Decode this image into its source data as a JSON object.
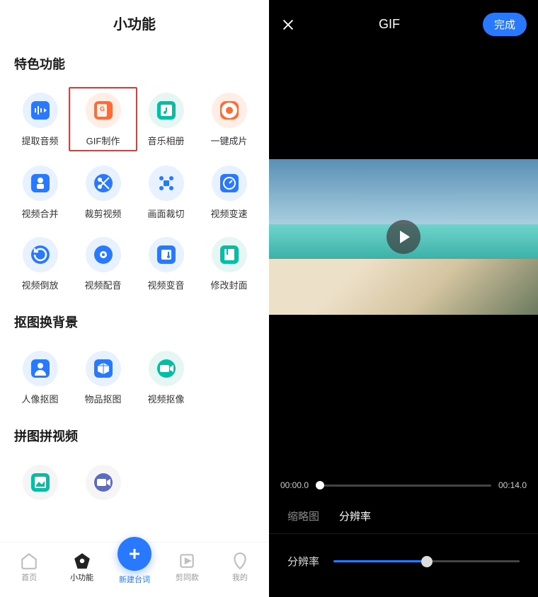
{
  "left": {
    "header_title": "小功能",
    "section1_title": "特色功能",
    "section2_title": "抠图换背景",
    "section3_title": "拼图拼视频",
    "items1": [
      {
        "label": "提取音频",
        "icon": "audio-extract-icon"
      },
      {
        "label": "GIF制作",
        "icon": "gif-icon"
      },
      {
        "label": "音乐相册",
        "icon": "music-album-icon"
      },
      {
        "label": "一键成片",
        "icon": "camera-icon"
      },
      {
        "label": "视频合并",
        "icon": "merge-icon"
      },
      {
        "label": "裁剪视频",
        "icon": "crop-video-icon"
      },
      {
        "label": "画面裁切",
        "icon": "frame-crop-icon"
      },
      {
        "label": "视频变速",
        "icon": "speed-icon"
      },
      {
        "label": "视频倒放",
        "icon": "reverse-icon"
      },
      {
        "label": "视频配音",
        "icon": "dub-icon"
      },
      {
        "label": "视频变音",
        "icon": "voice-icon"
      },
      {
        "label": "修改封面",
        "icon": "cover-icon"
      }
    ],
    "items2": [
      {
        "label": "人像抠图",
        "icon": "person-cutout-icon"
      },
      {
        "label": "物品抠图",
        "icon": "object-cutout-icon"
      },
      {
        "label": "视频抠像",
        "icon": "video-cutout-icon"
      }
    ],
    "highlighted_index": 1,
    "nav": {
      "home": "首页",
      "tools": "小功能",
      "center": "新建台词",
      "clip": "剪同款",
      "mine": "我的"
    }
  },
  "right": {
    "title": "GIF",
    "done": "完成",
    "time_start": "00:00.0",
    "time_end": "00:14.0",
    "tab_thumb": "缩略图",
    "tab_res": "分辨率",
    "active_tab": "分辨率",
    "res_label": "分辨率"
  }
}
